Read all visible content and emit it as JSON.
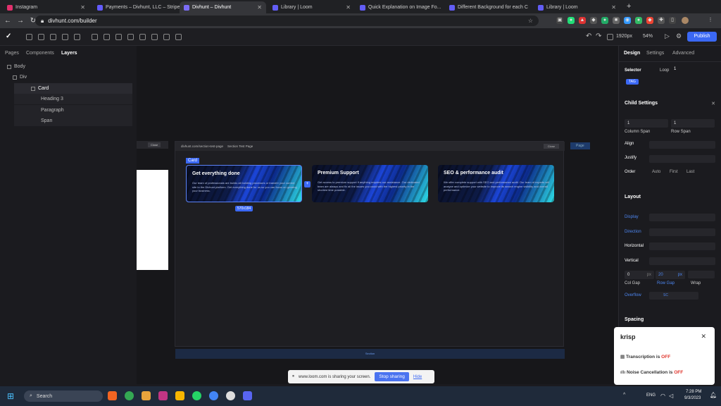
{
  "browser": {
    "tabs": [
      {
        "label": "Instagram",
        "color": "#e1306c"
      },
      {
        "label": "Payments – Divhunt, LLC – Stripe",
        "color": "#635bff"
      },
      {
        "label": "Divhunt – Divhunt",
        "color": "#7b6cf6",
        "active": true
      },
      {
        "label": "Library | Loom",
        "color": "#625df5"
      },
      {
        "label": "Quick Explanation on Image Fo...",
        "color": "#625df5"
      },
      {
        "label": "Different Background for each C",
        "color": "#625df5"
      },
      {
        "label": "Library | Loom",
        "color": "#625df5"
      }
    ],
    "url": "divhunt.com/builder"
  },
  "toolbar": {
    "resolution": "1920px",
    "zoom": "54%",
    "publish": "Publish"
  },
  "left_panel": {
    "tabs": [
      "Pages",
      "Components",
      "Layers"
    ],
    "layers": [
      {
        "label": "Body",
        "indent": 0
      },
      {
        "label": "Div",
        "indent": 1
      },
      {
        "label": "Card",
        "indent": 2,
        "selected": true
      },
      {
        "label": "Heading 3",
        "indent": 3
      },
      {
        "label": "Paragraph",
        "indent": 3
      },
      {
        "label": "Span",
        "indent": 3
      }
    ]
  },
  "canvas": {
    "frame_url": "divhunt.com/section-test-page",
    "frame_title": "Section Test Page",
    "frame_close": "Close",
    "left_close": "Close",
    "page_tag": "Page",
    "card_tag": "Card",
    "size_badge": "570x184",
    "bottom_label": "Section",
    "cards": [
      {
        "title": "Get everything done",
        "text": "Our team of professionals are builds all building processes or transfer your current site to the Divhunt platform. Get everything done for us so you can focus on growing your business."
      },
      {
        "title": "Premium Support",
        "text": "Get access to premium support if anything requires our assistance. Our dedicated team are always and fix all the issues you could with the highest priority in the shortest time possible."
      },
      {
        "title": "SEO & performance audit",
        "text": "We offer complete support with SEO and performance audit. Our team of experts will analyze and optimize your website to improve its search engine visibility and overall performance."
      }
    ]
  },
  "right_panel": {
    "tabs": [
      "Design",
      "Settings",
      "Advanced"
    ],
    "selector_label": "Selector",
    "loop_label": "Loop",
    "loop_value": "1",
    "tag": "TAG",
    "child_settings": "Child Settings",
    "column_span": "1",
    "column_span_label": "Column Span",
    "row_span": "1",
    "row_span_label": "Row Span",
    "align_label": "Align",
    "justify_label": "Justify",
    "order_label": "Order",
    "order_options": [
      "Auto",
      "First",
      "Last"
    ],
    "layout_label": "Layout",
    "display_label": "Display",
    "direction_label": "Direction",
    "horizontal_label": "Horizontal",
    "vertical_label": "Vertical",
    "col_gap_value": "0",
    "row_gap_value": "20",
    "gap_unit": "px",
    "col_gap_label": "Col Gap",
    "row_gap_label": "Row Gap",
    "wrap_label": "Wrap",
    "overflow_label": "Overflow",
    "overflow_value": "SC",
    "spacing_label": "Spacing"
  },
  "krisp": {
    "brand": "krisp",
    "transcription": "Transcription is ",
    "transcription_state": "OFF",
    "noise": "Noise Cancellation is ",
    "noise_state": "OFF"
  },
  "loom": {
    "message": "www.loom.com is sharing your screen.",
    "stop": "Stop sharing",
    "hide": "Hide"
  },
  "taskbar": {
    "search": "Search",
    "lang": "ENG",
    "time": "7:28 PM",
    "date": "9/3/2023"
  }
}
